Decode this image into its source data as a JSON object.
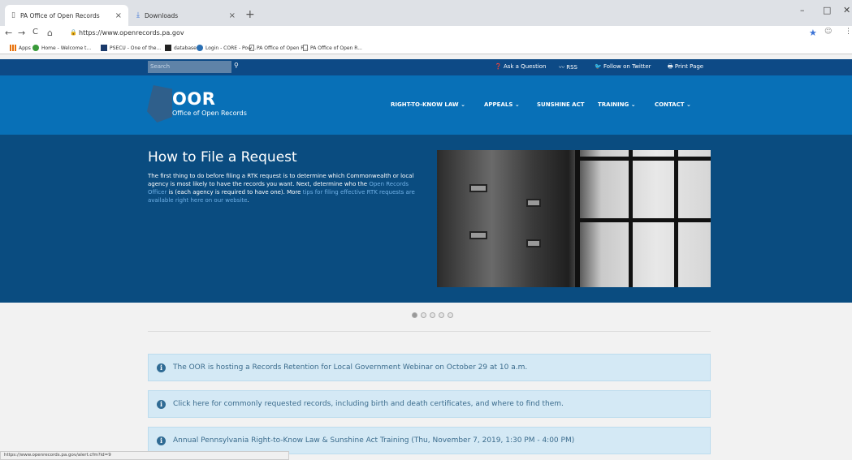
{
  "browser": {
    "tabs": [
      {
        "title": "PA Office of Open Records",
        "close": "×"
      },
      {
        "title": "Downloads",
        "close": "×"
      }
    ],
    "new_tab": "+",
    "window_controls": {
      "minimize": "–",
      "maximize": "□",
      "close": "✕"
    },
    "nav": {
      "back": "←",
      "forward": "→",
      "reload": "C",
      "home": "⌂"
    },
    "url": "https://www.openrecords.pa.gov",
    "bookmarks": [
      {
        "label": "Apps",
        "color": "#e8710a"
      },
      {
        "label": "Home - Welcome t...",
        "color": "#3a9a3a"
      },
      {
        "label": "PSECU - One of the...",
        "color": "#1a3a6b"
      },
      {
        "label": "database",
        "color": "#222222"
      },
      {
        "label": "Login - CORE - Pow...",
        "color": "#2a6fb3"
      },
      {
        "label": "PA Office of Open R...",
        "color": "#777777"
      },
      {
        "label": "PA Office of Open R...",
        "color": "#777777"
      }
    ],
    "status_url": "https://www.openrecords.pa.gov/alert.cfm?id=9"
  },
  "site": {
    "search": {
      "placeholder": "Search",
      "button_glyph": "⚲"
    },
    "utility": {
      "ask": "Ask a Question",
      "rss": "RSS",
      "twitter": "Follow on Twitter",
      "print": "Print Page"
    },
    "logo": {
      "title": "OOR",
      "subtitle": "Office of Open Records"
    },
    "menu": [
      {
        "label": "RIGHT-TO-KNOW LAW",
        "caret": "⌄"
      },
      {
        "label": "APPEALS",
        "caret": "⌄"
      },
      {
        "label": "SUNSHINE ACT",
        "caret": ""
      },
      {
        "label": "TRAINING",
        "caret": "⌄"
      },
      {
        "label": "CONTACT",
        "caret": "⌄"
      }
    ],
    "hero": {
      "title": "How to File a Request",
      "text_1": "The first thing to do before filing a RTK request is to determine which Commonwealth or local agency is most likely to have the records you want. Next, determine who the ",
      "link_1": "Open Records Officer",
      "text_2": " is (each agency is required to have one). More ",
      "link_2": "tips for filing effective RTK requests are available right here on our website",
      "text_3": "."
    },
    "carousel": {
      "slides": 5,
      "active_index": 0
    },
    "alerts": [
      "The OOR is hosting a Records Retention for Local Government Webinar on October 29 at 10 a.m.",
      "Click here for commonly requested records, including birth and death certificates, and where to find them.",
      "Annual Pennsylvania Right-to-Know Law & Sunshine Act Training (Thu, November 7, 2019, 1:30 PM - 4:00 PM)"
    ],
    "colors": {
      "topbar": "#0d4a86",
      "masthead": "#0870b7",
      "hero": "#0a4c80",
      "alert_bg": "#d4e9f5",
      "alert_text": "#3a6b8c"
    }
  }
}
